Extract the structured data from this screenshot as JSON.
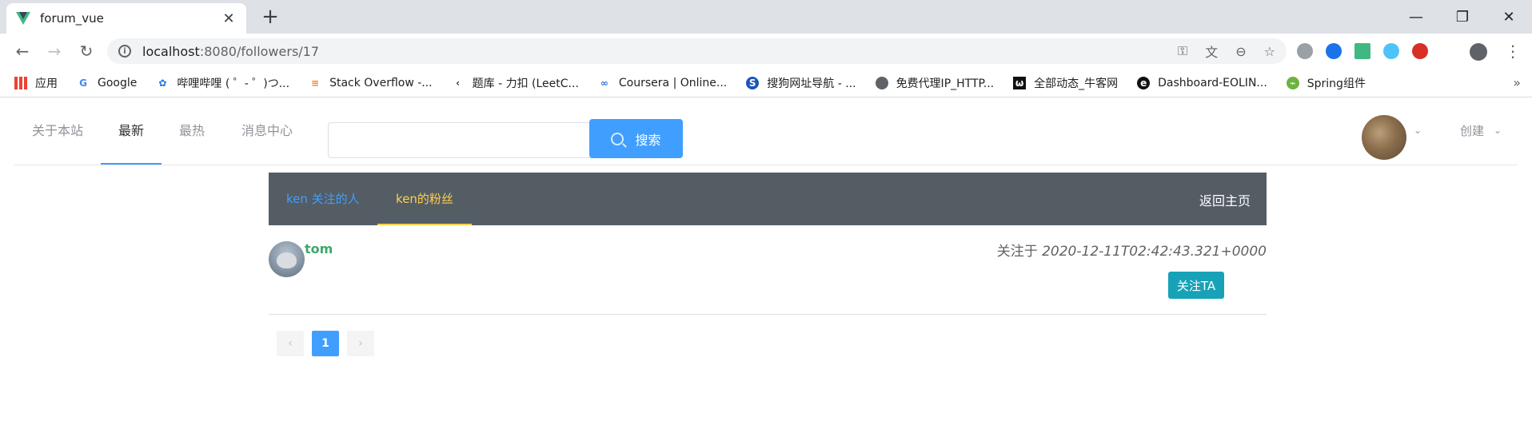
{
  "browser": {
    "tab_title": "forum_vue",
    "url_host": "localhost",
    "url_path": ":8080/followers/17",
    "bookmarks": [
      {
        "label": "应用",
        "icon": "apps-grid-icon"
      },
      {
        "label": "Google",
        "icon": "google-icon"
      },
      {
        "label": "哔哩哔哩 ( ゜- ゜)つ...",
        "icon": "bilibili-icon"
      },
      {
        "label": "Stack Overflow -...",
        "icon": "stackoverflow-icon"
      },
      {
        "label": "题库 - 力扣 (LeetC...",
        "icon": "leetcode-icon"
      },
      {
        "label": "Coursera | Online...",
        "icon": "coursera-icon"
      },
      {
        "label": "搜狗网址导航 - ...",
        "icon": "sogou-icon"
      },
      {
        "label": "免费代理IP_HTTP...",
        "icon": "globe-icon"
      },
      {
        "label": "全部动态_牛客网",
        "icon": "nowcoder-icon"
      },
      {
        "label": "Dashboard-EOLIN...",
        "icon": "eolinker-icon"
      },
      {
        "label": "Spring组件",
        "icon": "spring-icon"
      }
    ]
  },
  "nav": {
    "about": "关于本站",
    "latest": "最新",
    "hottest": "最热",
    "messages": "消息中心",
    "search_button": "搜索",
    "create": "创建"
  },
  "subnav": {
    "tab_following": "ken 关注的人",
    "tab_followers": "ken的粉丝",
    "home": "返回主页"
  },
  "followers": [
    {
      "name": "tom",
      "followed_prefix": "关注于",
      "followed_at": "2020-12-11T02:42:43.321+0000",
      "follow_button": "关注TA"
    }
  ],
  "pagination": {
    "current": "1",
    "prev": "‹",
    "next": "›"
  },
  "colors": {
    "primary": "#409eff",
    "subnav_bg": "#545c64",
    "active_tab": "#ffd04b",
    "follow_btn": "#17a2b8",
    "username": "#3da86a"
  }
}
